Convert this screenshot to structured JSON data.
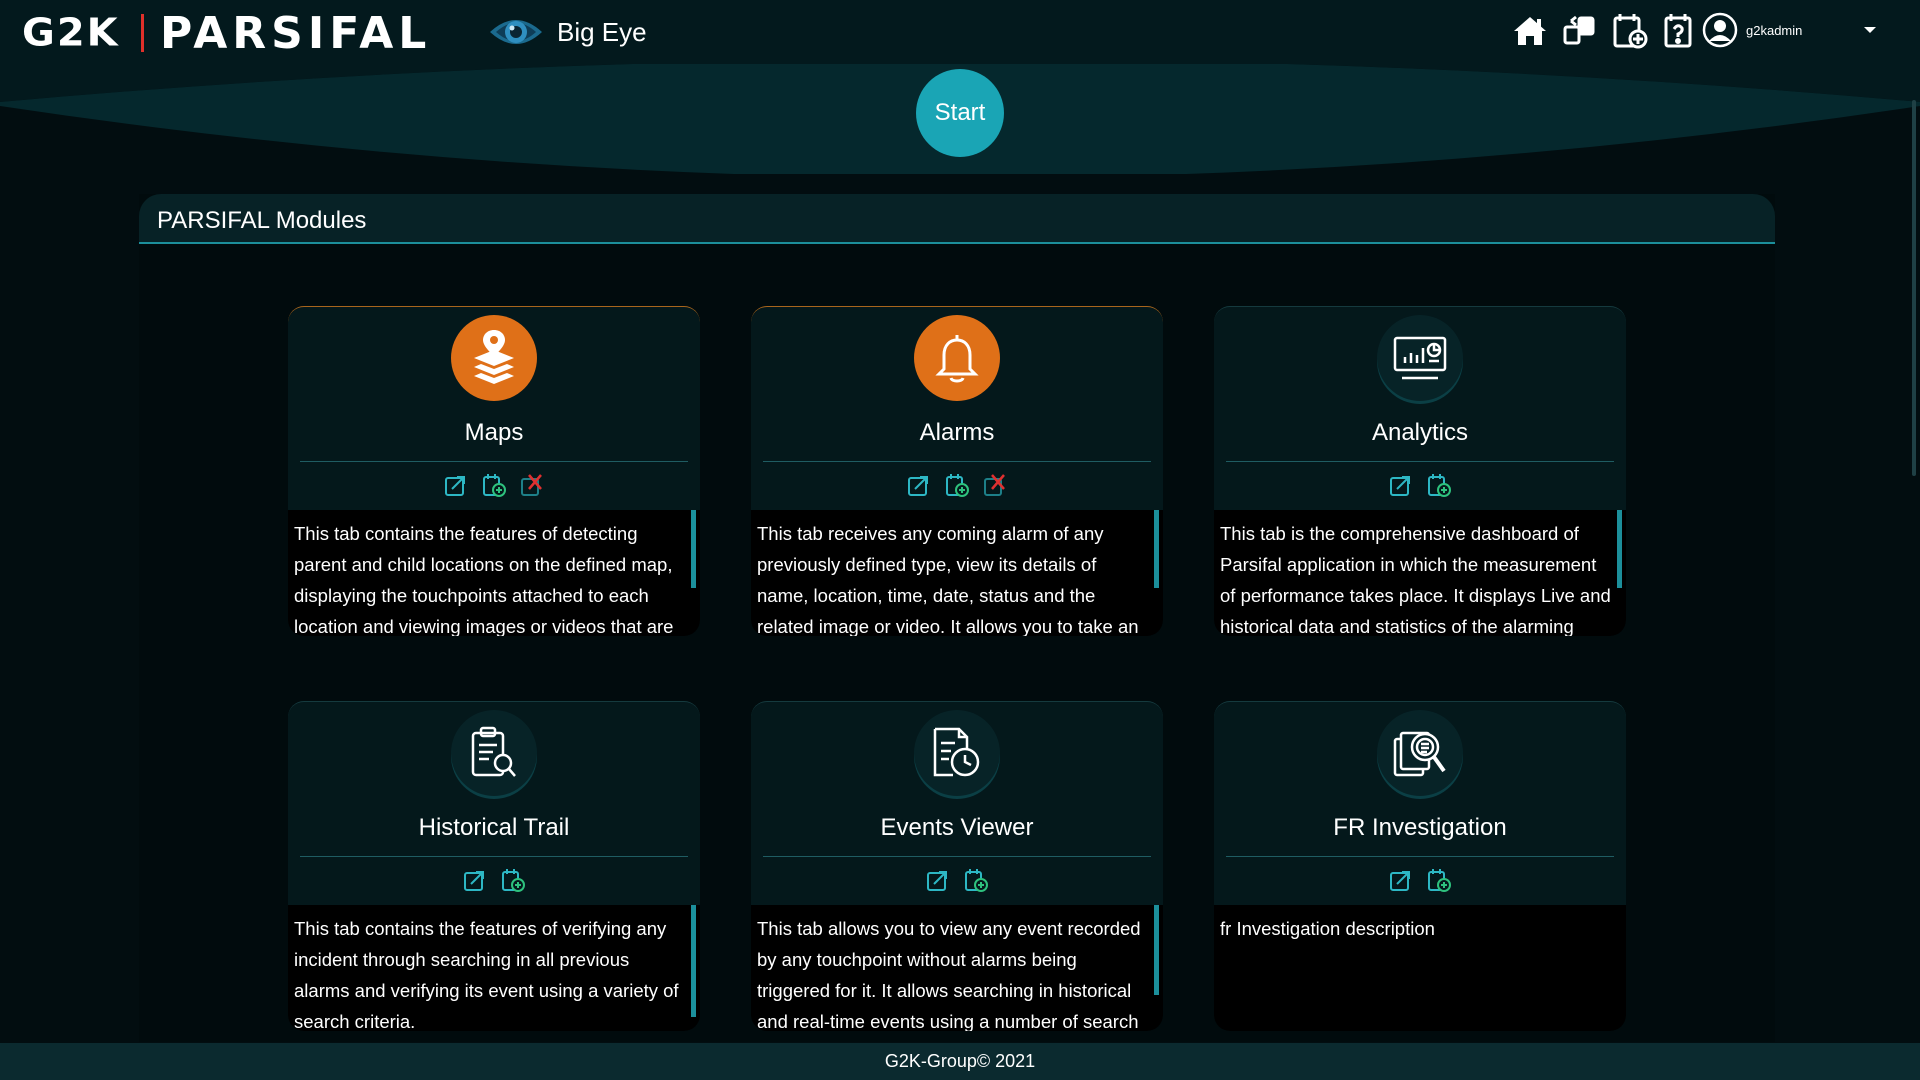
{
  "header": {
    "logo_company": "G2K",
    "logo_product": "PARSIFAL",
    "app_name": "Big Eye",
    "icons": [
      "home-icon",
      "switch-layout-icon",
      "add-tab-icon",
      "help-icon"
    ],
    "user": {
      "name": "g2kadmin",
      "avatar_icon": "user-avatar-icon"
    }
  },
  "hero": {
    "start_label": "Start"
  },
  "modules": {
    "title": "PARSIFAL Modules",
    "cards": [
      {
        "title": "Maps",
        "icon": "map-layers-pin-icon",
        "icon_style": "orange",
        "actions": [
          "open-module-icon",
          "add-to-tab-icon",
          "remove-alert-icon"
        ],
        "description": "This tab contains the features of detecting parent and child locations on the defined map, displaying the touchpoints attached to each location and viewing images or videos that are"
      },
      {
        "title": "Alarms",
        "icon": "bell-icon",
        "icon_style": "orange",
        "actions": [
          "open-module-icon",
          "add-to-tab-icon",
          "remove-alert-icon"
        ],
        "description": "This tab receives any coming alarm of any previously defined type, view its details of name, location, time, date, status and the related image or video. It allows you to take an action toward"
      },
      {
        "title": "Analytics",
        "icon": "analytics-dashboard-icon",
        "icon_style": "dark",
        "actions": [
          "open-module-icon",
          "add-to-tab-icon"
        ],
        "description": "This tab is the comprehensive dashboard of Parsifal application in which the measurement of performance takes place. It displays Live and historical data and statistics of the alarming"
      },
      {
        "title": "Historical Trail",
        "icon": "clipboard-search-icon",
        "icon_style": "dark",
        "actions": [
          "open-module-icon",
          "add-to-tab-icon"
        ],
        "description": "This tab contains the features of verifying any incident through searching in all previous alarms and verifying its event using a variety of search criteria."
      },
      {
        "title": "Events Viewer",
        "icon": "document-clock-icon",
        "icon_style": "dark",
        "actions": [
          "open-module-icon",
          "add-to-tab-icon"
        ],
        "description": "This tab allows you to view any event recorded by any touchpoint without alarms being triggered for it. It allows searching in historical and real-time events using a number of search"
      },
      {
        "title": "FR Investigation",
        "icon": "face-search-icon",
        "icon_style": "dark",
        "actions": [
          "open-module-icon",
          "add-to-tab-icon"
        ],
        "description": "fr Investigation description"
      }
    ]
  },
  "footer": {
    "text": "G2K-Group© 2021"
  },
  "colors": {
    "accent_teal": "#1aa5b5",
    "alert_orange": "#df7018",
    "background": "#020d10"
  }
}
